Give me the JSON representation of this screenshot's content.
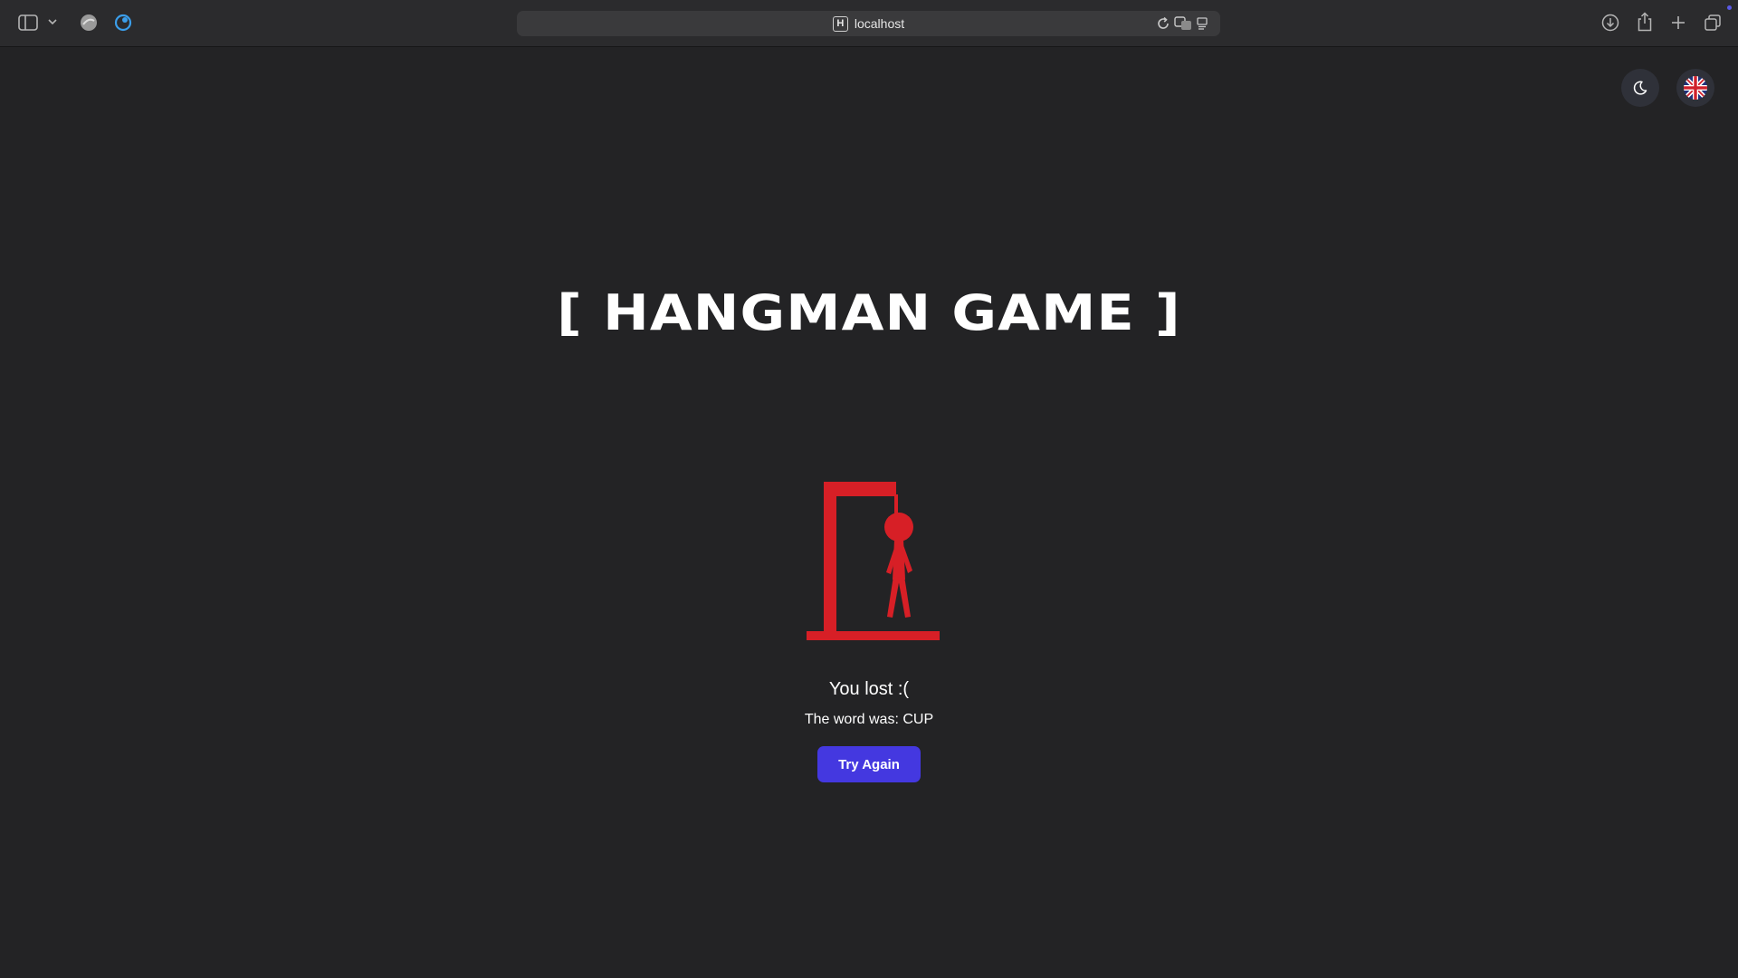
{
  "browser": {
    "url": "localhost",
    "favicon_letter": "H"
  },
  "game": {
    "title": "[ HANGMAN GAME ]",
    "result_text": "You lost :(",
    "word_label": "The word was:",
    "word": "CUP",
    "try_again_label": "Try Again",
    "hangman_color": "#d71f26",
    "button_color": "#4438e0",
    "background_color": "#232325"
  },
  "controls": {
    "theme_icon": "moon-icon",
    "language_icon": "uk-flag-icon"
  }
}
